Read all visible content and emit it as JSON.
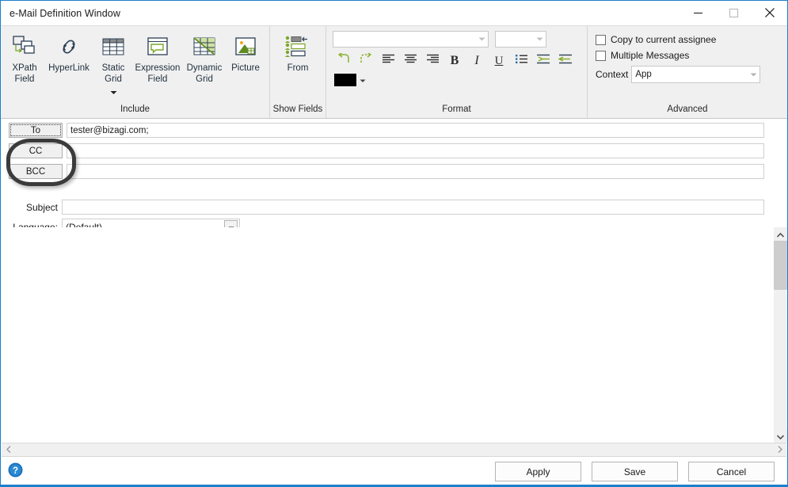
{
  "window": {
    "title": "e-Mail Definition Window",
    "controls": {
      "minimize": "minimize-icon",
      "maximize": "maximize-icon",
      "close": "close-icon"
    }
  },
  "ribbon": {
    "groups": [
      {
        "name": "include",
        "label": "Include",
        "buttons": [
          {
            "label_line1": "XPath",
            "label_line2": "Field",
            "icon": "xpath-field-icon",
            "has_caret": false
          },
          {
            "label_line1": "HyperLink",
            "label_line2": "",
            "icon": "hyperlink-icon",
            "has_caret": false
          },
          {
            "label_line1": "Static",
            "label_line2": "Grid",
            "icon": "static-grid-icon",
            "has_caret": true
          },
          {
            "label_line1": "Expression",
            "label_line2": "Field",
            "icon": "expression-field-icon",
            "has_caret": false
          },
          {
            "label_line1": "Dynamic",
            "label_line2": "Grid",
            "icon": "dynamic-grid-icon",
            "has_caret": false
          },
          {
            "label_line1": "Picture",
            "label_line2": "",
            "icon": "picture-icon",
            "has_caret": false
          }
        ]
      },
      {
        "name": "show-fields",
        "label": "Show Fields",
        "buttons": [
          {
            "label_line1": "From",
            "label_line2": "",
            "icon": "from-field-icon",
            "has_caret": false
          }
        ]
      },
      {
        "name": "format",
        "label": "Format",
        "font_name": {
          "value": "",
          "placeholder": ""
        },
        "font_size": {
          "value": "",
          "placeholder": ""
        },
        "tools": [
          {
            "name": "undo",
            "icon": "undo-arrow-icon"
          },
          {
            "name": "redo",
            "icon": "redo-arrow-icon"
          },
          {
            "name": "align-left",
            "icon": "align-left-icon"
          },
          {
            "name": "align-center",
            "icon": "align-center-icon"
          },
          {
            "name": "align-right",
            "icon": "align-right-icon"
          },
          {
            "name": "bold",
            "icon": "bold-icon",
            "glyph": "B"
          },
          {
            "name": "italic",
            "icon": "italic-icon",
            "glyph": "I"
          },
          {
            "name": "underline",
            "icon": "underline-icon",
            "glyph": "U"
          },
          {
            "name": "bullet-list",
            "icon": "bullet-list-icon"
          },
          {
            "name": "increase-indent",
            "icon": "increase-indent-icon"
          },
          {
            "name": "decrease-indent",
            "icon": "decrease-indent-icon"
          }
        ],
        "font_color": "#000000"
      },
      {
        "name": "advanced",
        "label": "Advanced",
        "checkboxes": [
          {
            "label": "Copy to current assignee",
            "checked": false
          },
          {
            "label": "Multiple Messages",
            "checked": false
          }
        ],
        "context": {
          "label": "Context",
          "value": "App"
        }
      }
    ]
  },
  "fields": {
    "to": {
      "button": "To",
      "value": "tester@bizagi.com;",
      "placeholder": ""
    },
    "cc": {
      "button": "CC",
      "value": "",
      "placeholder": ""
    },
    "bcc": {
      "button": "BCC",
      "value": "",
      "placeholder": ""
    },
    "subject": {
      "label": "Subject",
      "value": "",
      "placeholder": ""
    },
    "language": {
      "label": "Language:",
      "value": "(Default)"
    }
  },
  "annotation": {
    "name": "cc-bcc-highlight-ellipse",
    "color": "#3b3b3b"
  },
  "editor": {
    "content": "",
    "scroll": {
      "vertical": "visible",
      "horizontal": "visible"
    }
  },
  "footer": {
    "help": "help-icon",
    "buttons": [
      {
        "label": "Apply"
      },
      {
        "label": "Save"
      },
      {
        "label": "Cancel"
      }
    ]
  }
}
